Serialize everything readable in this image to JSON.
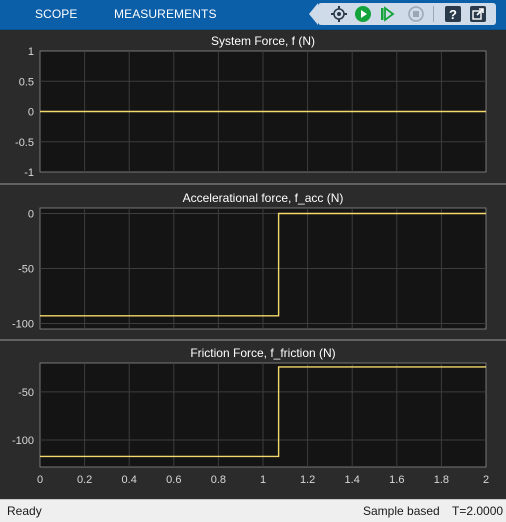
{
  "toolbar": {
    "tabs": [
      {
        "label": "SCOPE"
      },
      {
        "label": "MEASUREMENTS"
      }
    ],
    "icons": [
      "settings-icon",
      "run-icon",
      "step-forward-icon",
      "stop-icon",
      "help-icon",
      "undock-icon"
    ],
    "colors": {
      "bar": "#0b5ea8",
      "controls": "#cfdbe8",
      "run": "#12a33a"
    }
  },
  "chart_data": [
    {
      "type": "line",
      "title": "System Force, f (N)",
      "xlim": [
        0,
        2
      ],
      "ylim": [
        -1,
        1
      ],
      "yticks": [
        1,
        0.5,
        0,
        -0.5,
        -1
      ],
      "xticks": [
        0,
        0.2,
        0.4,
        0.6,
        0.8,
        1,
        1.2,
        1.4,
        1.6,
        1.8,
        2
      ],
      "grid": true,
      "series": [
        {
          "color": "#f5d96b",
          "x": [
            0,
            2
          ],
          "y": [
            0,
            0
          ]
        }
      ]
    },
    {
      "type": "line",
      "title": "Accelerational force, f_acc (N)",
      "xlim": [
        0,
        2
      ],
      "ylim": [
        -105,
        5
      ],
      "yticks": [
        0,
        -50,
        -100
      ],
      "xticks": [
        0,
        0.2,
        0.4,
        0.6,
        0.8,
        1,
        1.2,
        1.4,
        1.6,
        1.8,
        2
      ],
      "grid": true,
      "series": [
        {
          "color": "#f5d96b",
          "x": [
            0,
            1.07,
            1.07,
            2
          ],
          "y": [
            -93,
            -93,
            0,
            0
          ]
        }
      ]
    },
    {
      "type": "line",
      "title": "Friction Force, f_friction (N)",
      "xlim": [
        0,
        2
      ],
      "ylim": [
        -128,
        -20
      ],
      "yticks": [
        -50,
        -100
      ],
      "xticks": [
        0,
        0.2,
        0.4,
        0.6,
        0.8,
        1,
        1.2,
        1.4,
        1.6,
        1.8,
        2
      ],
      "xticklabels": [
        "0",
        "0.2",
        "0.4",
        "0.6",
        "0.8",
        "1",
        "1.2",
        "1.4",
        "1.6",
        "1.8",
        "2"
      ],
      "grid": true,
      "series": [
        {
          "color": "#f5d96b",
          "x": [
            0,
            1.07,
            1.07,
            2
          ],
          "y": [
            -117,
            -117,
            -24,
            -24
          ]
        }
      ]
    }
  ],
  "status": {
    "left": "Ready",
    "mode": "Sample based",
    "time": "T=2.0000"
  }
}
